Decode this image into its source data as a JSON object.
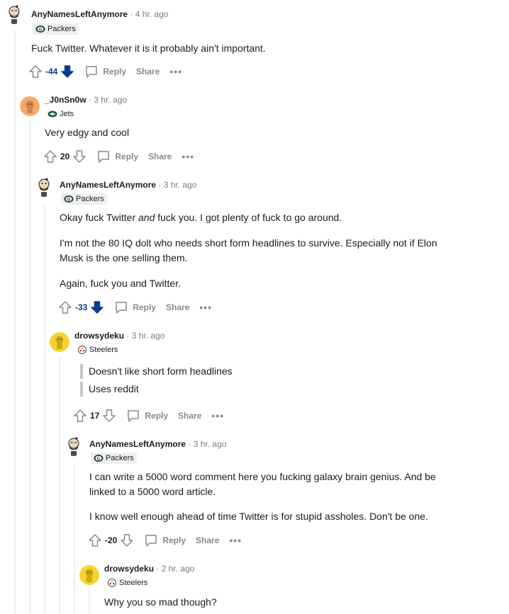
{
  "comments": [
    {
      "username": "AnyNamesLeftAnymore",
      "time": "4 hr. ago",
      "flair": "Packers",
      "avatar": "bearded-snoo-avatar",
      "paragraphs": [
        "Fuck Twitter. Whatever it is it probably ain't important."
      ],
      "score": "-44",
      "vote_state": "downvoted",
      "reply_label": "Reply",
      "share_label": "Share",
      "more_label": "•••"
    },
    {
      "username": "_J0nSn0w",
      "time": "3 hr. ago",
      "flair": "Jets",
      "avatar": "orange-snoo-avatar",
      "paragraphs": [
        "Very edgy and cool"
      ],
      "score": "20",
      "vote_state": "none",
      "reply_label": "Reply",
      "share_label": "Share",
      "more_label": "•••"
    },
    {
      "username": "AnyNamesLeftAnymore",
      "time": "3 hr. ago",
      "flair": "Packers",
      "avatar": "bearded-snoo-avatar",
      "p1_before": "Okay fuck Twitter ",
      "p1_em": "and",
      "p1_after": " fuck you. I got plenty of fuck to go around.",
      "p2_line1": "I'm not the 80 IQ dolt who needs short form headlines to survive. Especially not if Elon",
      "p2_line2": "Musk is the one selling them.",
      "p3": "Again, fuck you and Twitter.",
      "score": "-33",
      "vote_state": "downvoted",
      "reply_label": "Reply",
      "share_label": "Share",
      "more_label": "•••"
    },
    {
      "username": "drowsydeku",
      "time": "3 hr. ago",
      "flair": "Steelers",
      "avatar": "yellow-snoo-avatar",
      "quotes": [
        "Doesn't like short form headlines",
        "Uses reddit"
      ],
      "score": "17",
      "vote_state": "none",
      "reply_label": "Reply",
      "share_label": "Share",
      "more_label": "•••"
    },
    {
      "username": "AnyNamesLeftAnymore",
      "time": "3 hr. ago",
      "flair": "Packers",
      "avatar": "bearded-snoo-avatar",
      "p1_line1": "I can write a 5000 word comment here you fucking galaxy brain genius. And be",
      "p1_line2": "linked to a 5000 word article.",
      "p2": "I know well enough ahead of time Twitter is for stupid assholes. Don't be one.",
      "score": "-20",
      "vote_state": "none",
      "reply_label": "Reply",
      "share_label": "Share",
      "more_label": "•••"
    },
    {
      "username": "drowsydeku",
      "time": "2 hr. ago",
      "flair": "Steelers",
      "avatar": "yellow-snoo-avatar",
      "paragraphs": [
        "Why you so mad though?"
      ]
    }
  ],
  "separator": "·",
  "colors": {
    "downvote": "#0b3b8c",
    "muted": "#878a8c",
    "thread_line": "#edeff1",
    "packers_green": "#203731",
    "jets_green": "#125740"
  }
}
